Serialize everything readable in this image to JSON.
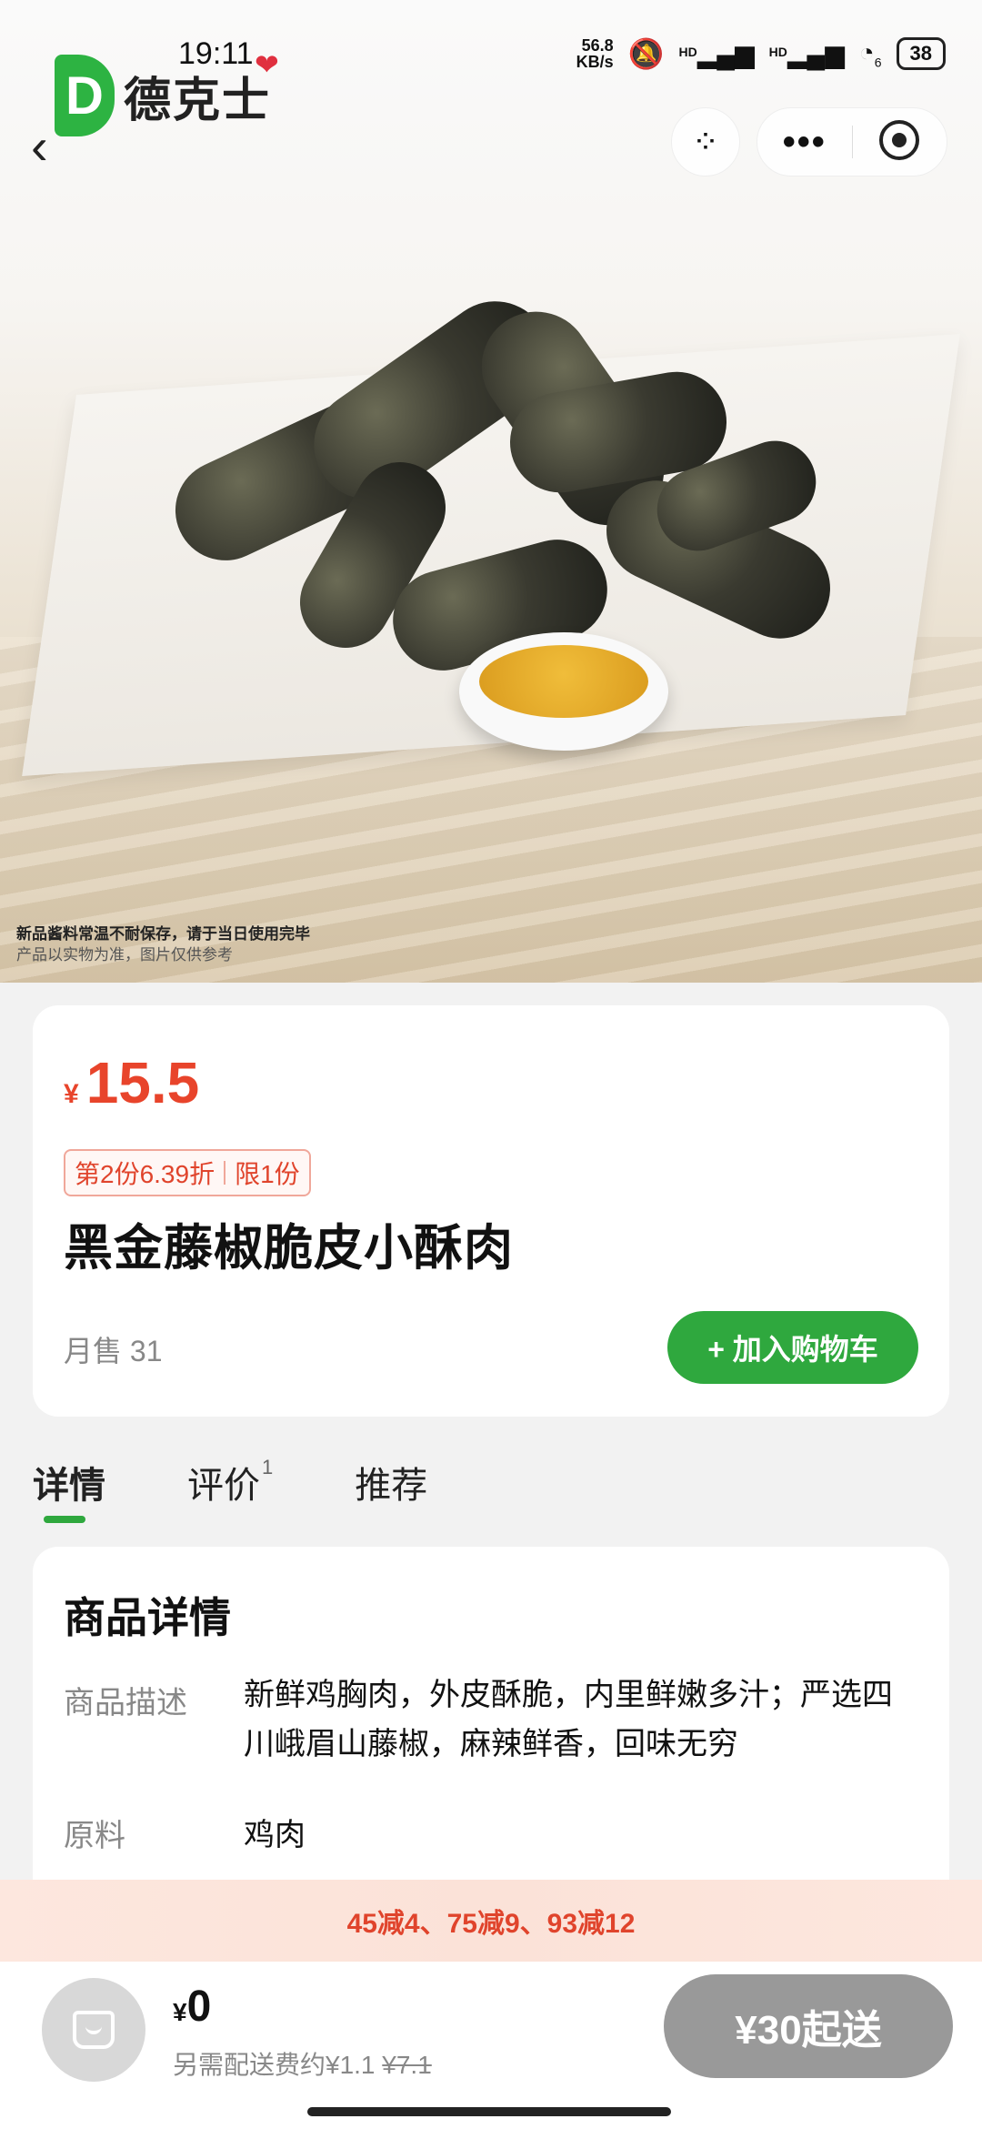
{
  "status_bar": {
    "time": "19:11",
    "net_speed_top": "56.8",
    "net_speed_unit": "KB/s",
    "signal1": "HD",
    "signal2": "HD",
    "wifi_level": "6",
    "battery": "38"
  },
  "header": {
    "logo_letter": "D",
    "logo_text": "德克士",
    "back_icon": "chevron-left-icon",
    "scan_icon": "scan-icon",
    "menu_icon": "more-dots-icon",
    "close_icon": "target-icon"
  },
  "hero": {
    "note_line1": "新品酱料常温不耐保存，请于当日使用完毕",
    "note_line2": "产品以实物为准，图片仅供参考"
  },
  "product": {
    "currency": "¥",
    "price": "15.5",
    "promo_discount": "第2份6.39折",
    "promo_limit": "限1份",
    "name": "黑金藤椒脆皮小酥肉",
    "monthly_sales": "月售 31",
    "add_to_cart": "+ 加入购物车"
  },
  "tabs": [
    {
      "label": "详情",
      "badge": ""
    },
    {
      "label": "评价",
      "badge": "1"
    },
    {
      "label": "推荐",
      "badge": ""
    }
  ],
  "details": {
    "title": "商品详情",
    "desc_label": "商品描述",
    "desc_value": "新鲜鸡胸肉，外皮酥脆，内里鲜嫩多汁；严选四川峨眉山藤椒，麻辣鲜香，回味无穷",
    "ingredient_label": "原料",
    "ingredient_value": "鸡肉"
  },
  "banner": {
    "text": "45减4、75减9、93减12"
  },
  "cart": {
    "currency": "¥",
    "total": "0",
    "fee_text": "另需配送费约¥1.1",
    "fee_original": "¥7.1",
    "min_order": "¥30起送"
  },
  "colors": {
    "brand_green": "#2fa83e",
    "price_red": "#e8442b",
    "disabled_gray": "#999999"
  }
}
